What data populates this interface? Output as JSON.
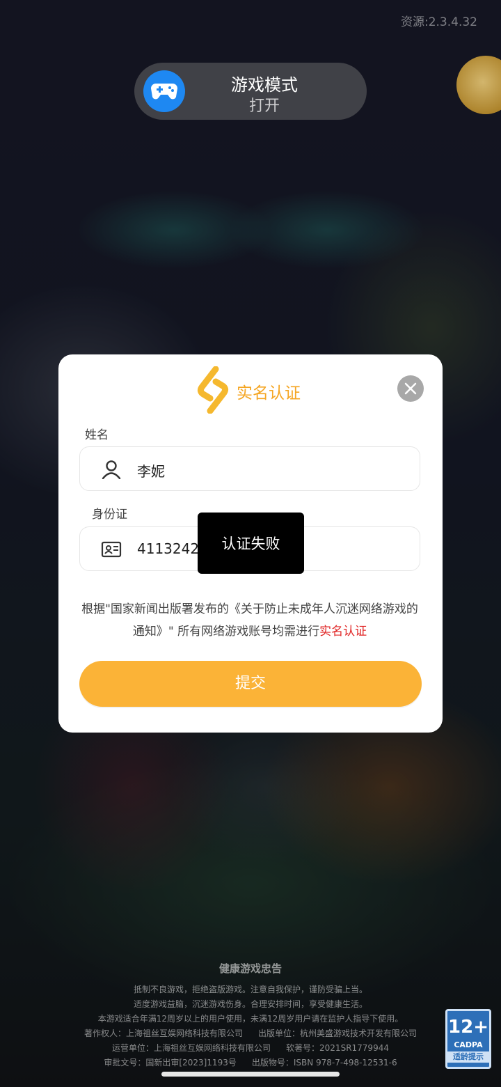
{
  "version_text": "资源:2.3.4.32",
  "game_mode": {
    "title": "游戏模式",
    "status": "打开"
  },
  "dialog": {
    "title": "实名认证",
    "name_label": "姓名",
    "name_value": "李妮",
    "id_label": "身份证",
    "id_value": "4113242",
    "notice_text": "根据\"国家新闻出版署发布的《关于防止未成年人沉迷网络游戏的通知》\" 所有网络游戏账号均需进行",
    "notice_highlight": "实名认证",
    "submit_label": "提交",
    "accent_color": "#fbb337",
    "highlight_color": "#e02424"
  },
  "toast": {
    "text": "认证失败"
  },
  "footer": {
    "title": "健康游戏忠告",
    "line1": "抵制不良游戏，拒绝盗版游戏。注意自我保护，谨防受骗上当。",
    "line2": "适度游戏益脑，沉迷游戏伤身。合理安排时间，享受健康生活。",
    "line3": "本游戏适合年满12周岁以上的用户使用，未满12周岁用户请在监护人指导下使用。",
    "copyright": "著作权人：上海祖丝互娱网络科技有限公司",
    "publisher": "出版单位：杭州美盛游戏技术开发有限公司",
    "operator": "运营单位：上海祖丝互娱网络科技有限公司",
    "software_no": "软著号：2021SR1779944",
    "approval_no": "审批文号：国新出审[2023]1193号",
    "isbn": "出版物号：ISBN 978-7-498-12531-6"
  },
  "age_badge": {
    "age": "12+",
    "org": "CADPA",
    "tip": "适龄提示"
  }
}
